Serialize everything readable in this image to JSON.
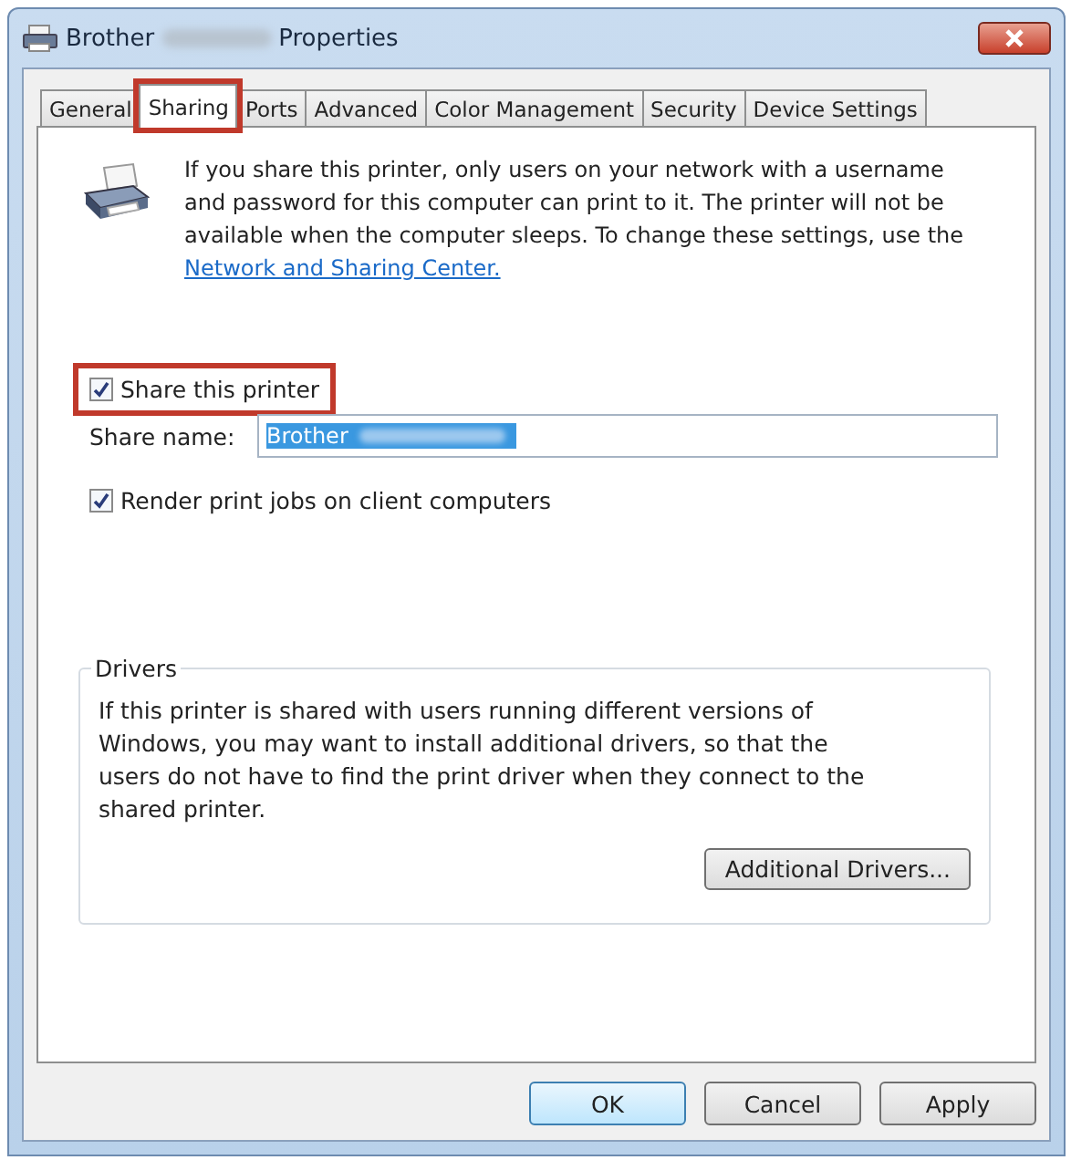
{
  "window": {
    "title_start": "Brother",
    "title_end": "Properties",
    "title_redacted": true
  },
  "tabs": [
    {
      "label": "General",
      "selected": false,
      "highlighted": false
    },
    {
      "label": "Sharing",
      "selected": true,
      "highlighted": true
    },
    {
      "label": "Ports",
      "selected": false,
      "highlighted": false
    },
    {
      "label": "Advanced",
      "selected": false,
      "highlighted": false
    },
    {
      "label": "Color Management",
      "selected": false,
      "highlighted": false
    },
    {
      "label": "Security",
      "selected": false,
      "highlighted": false
    },
    {
      "label": "Device Settings",
      "selected": false,
      "highlighted": false
    }
  ],
  "info": {
    "text": "If you share this printer, only users on your network with a username and password for this computer can print to it. The printer will not be available when the computer sleeps. To change these settings, use the",
    "link": "Network and Sharing Center."
  },
  "share_checkbox": {
    "label": "Share this printer",
    "checked": true,
    "highlighted": true
  },
  "share_name": {
    "label": "Share name:",
    "value": "Brother",
    "value_redacted": true,
    "selected": true
  },
  "render_checkbox": {
    "label": "Render print jobs on client computers",
    "checked": true
  },
  "drivers": {
    "title": "Drivers",
    "text": "If this printer is shared with users running different versions of Windows, you may want to install additional drivers, so that the users do not have to find the print driver when they connect to the shared printer.",
    "button": "Additional Drivers..."
  },
  "buttons": [
    {
      "label": "OK",
      "default": true
    },
    {
      "label": "Cancel",
      "default": false
    },
    {
      "label": "Apply",
      "default": false
    }
  ]
}
